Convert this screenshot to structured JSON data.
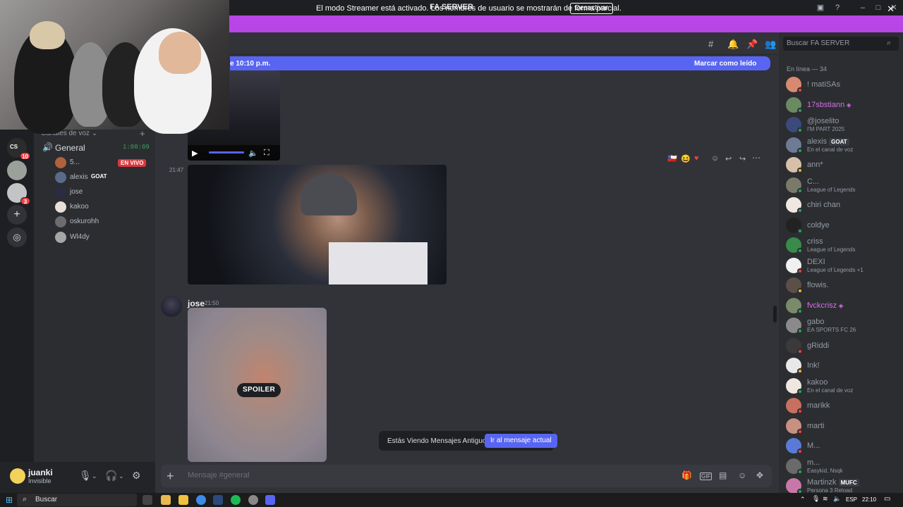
{
  "window": {
    "title": "FA SERVER"
  },
  "banner": {
    "text": "El modo Streamer está activado. Los nombres de usuario se mostrarán de forma parcial.",
    "button": "Desactivar"
  },
  "rail": {
    "servers": [
      {
        "name": "CS",
        "badge": "10",
        "color": "#2c2c2c"
      },
      {
        "name": "server-2",
        "badge": "",
        "color": "#9aa19a"
      },
      {
        "name": "server-3",
        "badge": "3",
        "color": "#c2c4c6"
      }
    ]
  },
  "channels": {
    "voice_header": "Canales de voz",
    "voice_channel": "General",
    "voice_time": "1:08:09",
    "live_label": "EN VIVO",
    "members": [
      {
        "name": "5...",
        "color": "#b0613b"
      },
      {
        "name": "alexis",
        "tag": "GOAT",
        "color": "#5a6b8a"
      },
      {
        "name": "jose",
        "color": "#2a2c44"
      },
      {
        "name": "kakoo",
        "color": "#e8e0d8"
      },
      {
        "name": "oskurohh",
        "color": "#6c6c70"
      },
      {
        "name": "Wl4dy",
        "color": "#a6a6a6"
      }
    ]
  },
  "user": {
    "name": "juanki",
    "status": "Invisible"
  },
  "chat": {
    "new_messages": "e 10:10 p.m.",
    "mark_read": "Marcar como leído",
    "message1_time": "21:47",
    "author": "jose",
    "author_time": "21:50",
    "spoiler": "SPOILER",
    "old_messages": "Estás Viendo Mensajes Antiguos",
    "jump_button": "Ir al mensaje actual",
    "composer_placeholder": "Mensaje #general"
  },
  "members": {
    "search_placeholder": "Buscar FA SERVER",
    "online_header": "En línea — 34",
    "list": [
      {
        "name": "! matiSAs",
        "color": "#d88a70",
        "status": "#f23f42"
      },
      {
        "name": "17sbstiann",
        "color": "#6a8a62",
        "status": "#23a55a",
        "nitro": true
      },
      {
        "name": "@joselito",
        "sub": "I'M PART 2025",
        "color": "#3b4a7a",
        "status": "#23a55a"
      },
      {
        "name": "alexis",
        "tag": "GOAT",
        "sub": "En el canal de voz",
        "color": "#6f7a94",
        "status": "#23a55a"
      },
      {
        "name": "ann*",
        "color": "#d8c0a8",
        "status": "#f0b232"
      },
      {
        "name": "C...",
        "sub": "League of Legends",
        "color": "#7a7a6a",
        "status": "#23a55a"
      },
      {
        "name": "chiri chan",
        "color": "#f0e8e0",
        "status": "#23a55a"
      },
      {
        "name": "coldye",
        "color": "#222",
        "status": "#23a55a"
      },
      {
        "name": "criss",
        "sub": "League of Legends",
        "color": "#3a8a4a",
        "status": "#23a55a"
      },
      {
        "name": "DEXI",
        "sub": "League of Legends +1",
        "color": "#f0f0f0",
        "status": "#f23f42"
      },
      {
        "name": "flowis.",
        "color": "#5a5048",
        "status": "#f0b232"
      },
      {
        "name": "fvckcrisz",
        "color": "#7a8a6a",
        "status": "#23a55a",
        "nitro": true
      },
      {
        "name": "gabo",
        "sub": "EA SPORTS FC 26",
        "color": "#8a8a8a",
        "status": "#23a55a"
      },
      {
        "name": "gRiddi",
        "color": "#3a3a3a",
        "status": "#f23f42"
      },
      {
        "name": "Ink!",
        "color": "#e8e8e8",
        "status": "#f0b232"
      },
      {
        "name": "kakoo",
        "sub": "En el canal de voz",
        "color": "#f0e8e0",
        "status": "#23a55a"
      },
      {
        "name": "marikk",
        "color": "#c87060",
        "status": "#f23f42"
      },
      {
        "name": "marti",
        "color": "#c89080",
        "status": "#f23f42"
      },
      {
        "name": "M...",
        "color": "#5a7ad8",
        "status": "#f23f42"
      },
      {
        "name": "m...",
        "sub": "Easykid, Nsqk",
        "color": "#6a6a6a",
        "status": "#23a55a"
      },
      {
        "name": "Martinzk",
        "tag": "MUFC",
        "sub": "Persona 3 Reload",
        "color": "#c878a8",
        "status": "#23a55a"
      }
    ]
  },
  "taskbar": {
    "search": "Buscar",
    "lang": "ESP",
    "time": "22:10"
  }
}
